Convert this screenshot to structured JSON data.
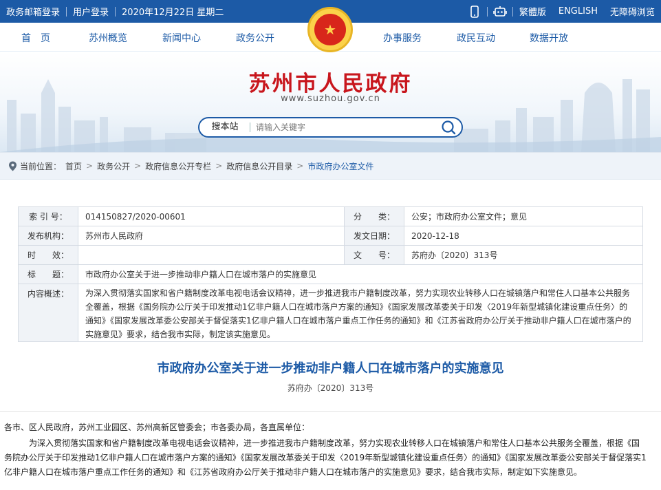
{
  "topbar": {
    "mail_login": "政务邮箱登录",
    "user_login": "用户登录",
    "date": "2020年12月22日 星期二",
    "traditional": "繁體版",
    "english": "ENGLISH",
    "accessible": "无障碍浏览",
    "icons": [
      "mobile-icon",
      "robot-icon"
    ]
  },
  "nav": {
    "items": [
      "首　页",
      "苏州概览",
      "新闻中心",
      "政务公开",
      "办事服务",
      "政民互动",
      "数据开放"
    ]
  },
  "header": {
    "title": "苏州市人民政府",
    "url": "www.suzhou.gov.cn"
  },
  "search": {
    "scope": "搜本站",
    "placeholder": "请输入关键字"
  },
  "breadcrumb": {
    "prefix": "当前位置：",
    "items": [
      "首页",
      "政务公开",
      "政府信息公开专栏",
      "政府信息公开目录"
    ],
    "current": "市政府办公室文件"
  },
  "meta": {
    "index_label": "索 引 号：",
    "index_value": "014150827/2020-00601",
    "category_label": "分　　类：",
    "category_value": "公安；市政府办公室文件；意见",
    "issuer_label": "发布机构：",
    "issuer_value": "苏州市人民政府",
    "date_label": "发文日期：",
    "date_value": "2020-12-18",
    "validity_label": "时　　效：",
    "validity_value": "",
    "docno_label": "文　　号：",
    "docno_value": "苏府办〔2020〕313号",
    "title_label": "标　　题：",
    "title_value": "市政府办公室关于进一步推动非户籍人口在城市落户的实施意见",
    "summary_label": "内容概述：",
    "summary_value": "为深入贯彻落实国家和省户籍制度改革电视电话会议精神，进一步推进我市户籍制度改革，努力实现农业转移人口在城镇落户和常住人口基本公共服务全覆盖，根据《国务院办公厅关于印发推动1亿非户籍人口在城市落户方案的通知》《国家发展改革委关于印发〈2019年新型城镇化建设重点任务〉的通知》《国家发展改革委公安部关于督促落实1亿非户籍人口在城市落户重点工作任务的通知》和《江苏省政府办公厅关于推动非户籍人口在城市落户的实施意见》要求，结合我市实际，制定该实施意见。"
  },
  "document": {
    "title": "市政府办公室关于进一步推动非户籍人口在城市落户的实施意见",
    "number": "苏府办〔2020〕313号",
    "addressee": "各市、区人民政府，苏州工业园区、苏州高新区管委会；市各委办局，各直属单位：",
    "paragraph": "为深入贯彻落实国家和省户籍制度改革电视电话会议精神，进一步推进我市户籍制度改革，努力实现农业转移人口在城镇落户和常住人口基本公共服务全覆盖，根据《国务院办公厅关于印发推动1亿非户籍人口在城市落户方案的通知》《国家发展改革委关于印发〈2019年新型城镇化建设重点任务〉的通知》《国家发展改革委公安部关于督促落实1亿非户籍人口在城市落户重点工作任务的通知》和《江苏省政府办公厅关于推动非户籍人口在城市落户的实施意见》要求，结合我市实际，制定如下实施意见。"
  },
  "colors": {
    "brand_blue": "#1c5aa6",
    "title_red": "#c8161d"
  }
}
